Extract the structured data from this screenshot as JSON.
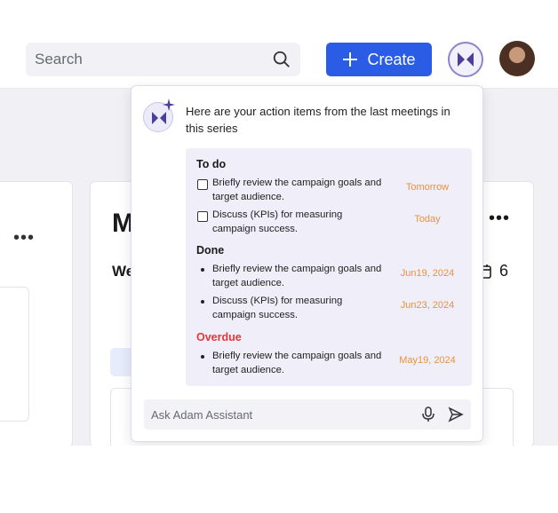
{
  "header": {
    "search_placeholder": "Search",
    "create_label": "Create",
    "icons": {
      "search": "search-icon",
      "plus": "plus-icon",
      "assistant": "adam-assistant-icon",
      "avatar": "user-avatar"
    }
  },
  "background": {
    "card_title_partial": "M",
    "card_subtitle_partial": "We",
    "card_count": "6",
    "menu_dots": "•••"
  },
  "assistant": {
    "intro": "Here are your action items from the last meetings in this series",
    "sections": [
      {
        "heading": "To do",
        "items": [
          {
            "text": "Briefly review the campaign goals and target audience.",
            "date": "Tomorrow"
          },
          {
            "text": "Discuss (KPIs) for measuring campaign success.",
            "date": "Today"
          }
        ]
      },
      {
        "heading": "Done",
        "items": [
          {
            "text": "Briefly review the campaign goals and target audience.",
            "date": "Jun19, 2024"
          },
          {
            "text": "Discuss (KPIs) for measuring campaign success.",
            "date": "Jun23, 2024"
          }
        ]
      },
      {
        "heading": "Overdue",
        "items": [
          {
            "text": "Briefly review the campaign goals and target audience.",
            "date": "May19, 2024"
          }
        ]
      }
    ],
    "input_placeholder": "Ask Adam Assistant",
    "colors": {
      "date": "#e8933c",
      "overdue": "#e0373f",
      "panel": "#efeef9",
      "primary": "#2b5ce6"
    }
  }
}
